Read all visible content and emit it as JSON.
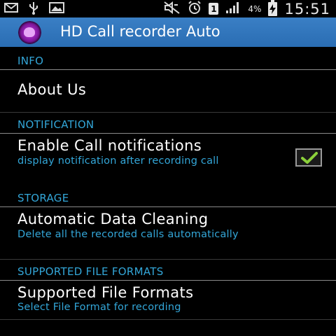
{
  "status_bar": {
    "battery_percent": "4%",
    "sim_indicator": "1",
    "time": "15:51",
    "icons": [
      "mail-icon",
      "usb-icon",
      "image-icon",
      "mute-icon",
      "alarm-icon",
      "sim-icon",
      "signal-icon",
      "battery-charging-icon"
    ]
  },
  "app": {
    "title": "HD Call recorder Auto",
    "icon": "app-logo-icon",
    "accent_color": "#33a6d8",
    "action_bar_color": "#3276bd"
  },
  "sections": [
    {
      "header": "INFO",
      "items": [
        {
          "title": "About Us",
          "summary": ""
        }
      ]
    },
    {
      "header": "NOTIFICATION",
      "items": [
        {
          "title": "Enable Call notifications",
          "summary": "display notification after recording call",
          "checked": true
        }
      ]
    },
    {
      "header": "STORAGE",
      "items": [
        {
          "title": "Automatic Data Cleaning",
          "summary": "Delete all the recorded calls automatically"
        }
      ]
    },
    {
      "header": "SUPPORTED FILE FORMATS",
      "items": [
        {
          "title": "Supported File Formats",
          "summary": "Select File Format for recording"
        }
      ]
    }
  ]
}
